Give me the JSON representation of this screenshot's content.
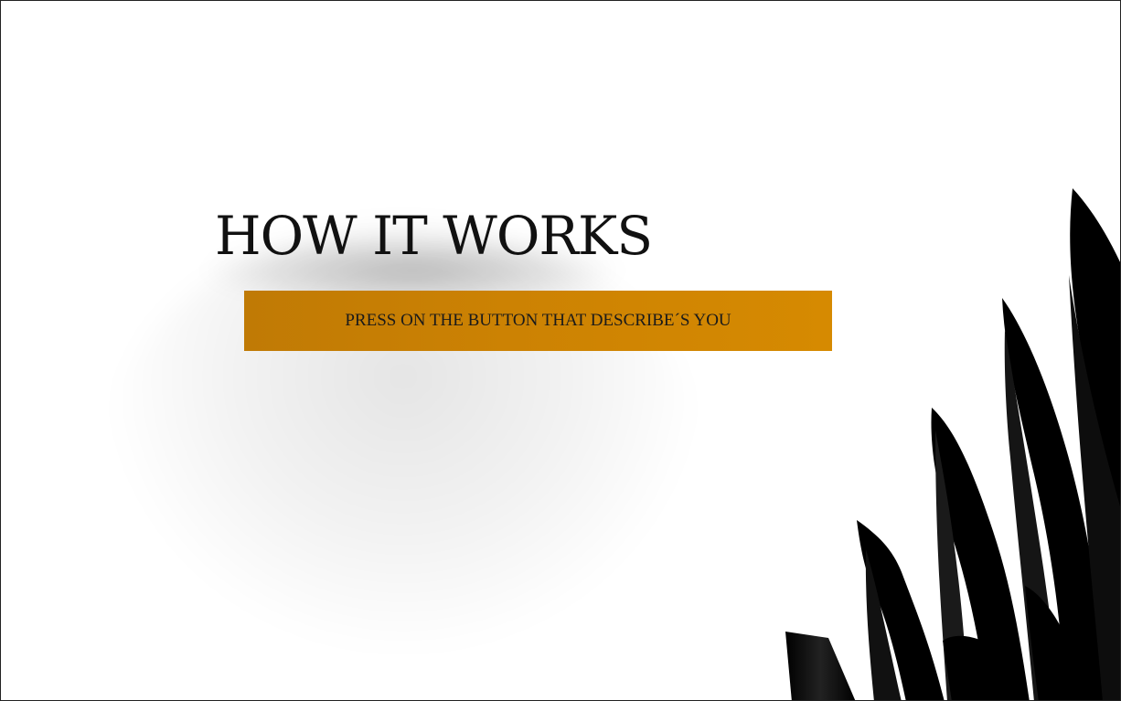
{
  "hero": {
    "title": "HOW IT WORKS",
    "button_label": "PRESS ON THE BUTTON THAT DESCRIBE´S YOU"
  },
  "colors": {
    "background": "#ffffff",
    "title": "#111111",
    "button_accent": "#d08503",
    "decor": "#000000"
  },
  "decor": {
    "icon": "abstract-black-ribbons"
  }
}
